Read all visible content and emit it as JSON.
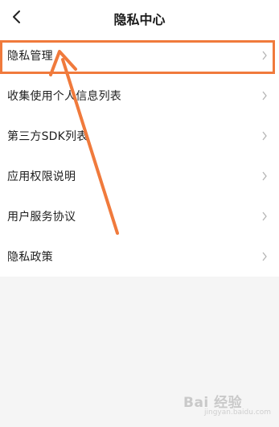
{
  "header": {
    "title": "隐私中心",
    "back_icon": "back-chevron-icon"
  },
  "list": {
    "items": [
      {
        "label": "隐私管理"
      },
      {
        "label": "收集使用个人信息列表"
      },
      {
        "label": "第三方SDK列表"
      },
      {
        "label": "应用权限说明"
      },
      {
        "label": "用户服务协议"
      },
      {
        "label": "隐私政策"
      }
    ],
    "chevron_icon": "chevron-right-icon"
  },
  "annotation": {
    "color": "#f07a3c"
  },
  "watermark": {
    "logo": "Bai 经验",
    "url": "jingyan.baidu.com"
  }
}
